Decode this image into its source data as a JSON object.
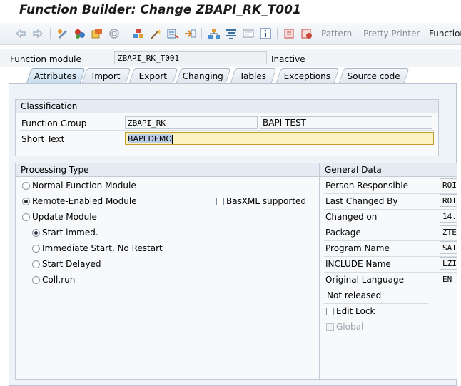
{
  "window": {
    "title": "Function Builder: Change ZBAPI_RK_T001"
  },
  "toolbar": {
    "icons": [
      "back-icon",
      "forward-icon",
      "display-change-icon",
      "other-object-icon",
      "activate-icon",
      "where-used-icon",
      "object-list-icon",
      "magic-wand-icon",
      "test-icon",
      "navigation-icon",
      "hierarchy-icon",
      "enhancement-icon",
      "block-icon",
      "info-icon",
      "cut-icon",
      "undo-icon"
    ],
    "pattern_label": "Pattern",
    "pretty_printer_label": "Pretty Printer",
    "function_label": "Function"
  },
  "header": {
    "function_module_label": "Function module",
    "function_module_value": "ZBAPI_RK_T001",
    "status": "Inactive"
  },
  "tabs": [
    {
      "label": "Attributes",
      "active": true
    },
    {
      "label": "Import"
    },
    {
      "label": "Export"
    },
    {
      "label": "Changing"
    },
    {
      "label": "Tables"
    },
    {
      "label": "Exceptions"
    },
    {
      "label": "Source code"
    }
  ],
  "classification": {
    "title": "Classification",
    "function_group_label": "Function Group",
    "function_group_value": "ZBAPI_RK",
    "function_group_desc": "BAPI TEST",
    "short_text_label": "Short Text",
    "short_text_value": "BAPI DEMO"
  },
  "processing_type": {
    "title": "Processing Type",
    "options": [
      {
        "label": "Normal Function Module",
        "selected": false
      },
      {
        "label": "Remote-Enabled Module",
        "selected": true
      },
      {
        "label": "Update Module",
        "selected": false
      }
    ],
    "basxml_label": "BasXML supported",
    "update_options": [
      {
        "label": "Start immed.",
        "selected": true
      },
      {
        "label": "Immediate Start, No Restart",
        "selected": false
      },
      {
        "label": "Start Delayed",
        "selected": false
      },
      {
        "label": "Coll.run",
        "selected": false
      }
    ]
  },
  "general_data": {
    "title": "General Data",
    "fields": [
      {
        "label": "Person Responsible",
        "value": "ROI"
      },
      {
        "label": "Last Changed By",
        "value": "ROI"
      },
      {
        "label": "Changed on",
        "value": "14."
      },
      {
        "label": "Package",
        "value": "ZTE"
      },
      {
        "label": "Program Name",
        "value": "SAI"
      },
      {
        "label": "INCLUDE Name",
        "value": "LZI"
      },
      {
        "label": "Original Language",
        "value": "EN"
      }
    ],
    "release_status": "Not released",
    "edit_lock_label": "Edit Lock",
    "global_label": "Global"
  }
}
